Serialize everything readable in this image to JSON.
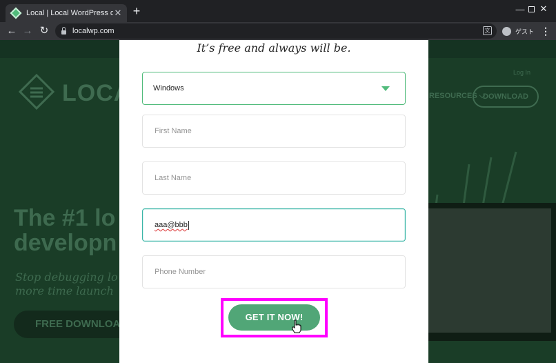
{
  "browser": {
    "tab_title": "Local | Local WordPress developm",
    "tab_close": "✕",
    "new_tab": "+",
    "url": "localwp.com",
    "profile_label": "ゲスト",
    "translate_glyph": "文",
    "menu_glyph": "⋮",
    "window_controls": {
      "minimize": "—",
      "maximize": "☐",
      "close": "✕"
    },
    "nav": {
      "back": "←",
      "forward": "→",
      "reload": "↻"
    }
  },
  "background": {
    "logo_text": "LOCAL",
    "signin": "Log In",
    "resources": "RESOURCES ⌵",
    "download": "DOWNLOAD",
    "headline": "The #1 lo\ndevelopn",
    "subline": "Stop debugging lo\nmore time launch",
    "free_download": "FREE DOWNLOA"
  },
  "modal": {
    "tagline": "It’s free and always will be.",
    "os_select": {
      "value": "Windows"
    },
    "first_name": {
      "placeholder": "First Name",
      "value": ""
    },
    "last_name": {
      "placeholder": "Last Name",
      "value": ""
    },
    "email": {
      "placeholder": "",
      "value": "aaa@bbb"
    },
    "phone": {
      "placeholder": "Phone Number",
      "value": ""
    },
    "submit_label": "GET IT NOW!"
  },
  "colors": {
    "brand_green": "#51bb7b",
    "button_green": "#51a677",
    "highlight": "#ff00ff",
    "focus_border": "#3cb6a8"
  }
}
